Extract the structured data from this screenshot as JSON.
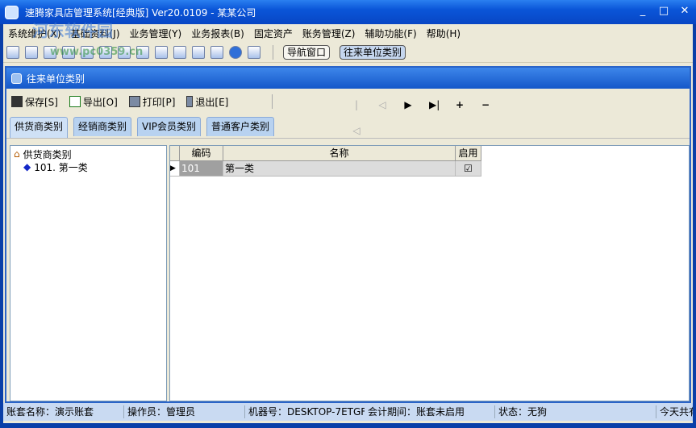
{
  "window": {
    "title": "速腾家具店管理系统[经典版] Ver20.0109  -  某某公司",
    "watermark": {
      "site_name": "河东软件园",
      "url": "www.pc0359.cn"
    }
  },
  "menu": [
    "系统维护(X)",
    "基础资料(J)",
    "业务管理(Y)",
    "业务报表(B)",
    "固定资产",
    "账务管理(Z)",
    "辅助功能(F)",
    "帮助(H)"
  ],
  "toolbar": {
    "icons": [
      "grid-icon",
      "form-icon",
      "windows-icon",
      "search-doc-icon",
      "money-icon",
      "edit-icon",
      "users-icon",
      "print-doc-icon",
      "notes-icon",
      "calculator-icon",
      "save-icon",
      "printer-icon",
      "help-icon",
      "exit-icon"
    ],
    "nav_buttons": [
      "导航窗口",
      "往来单位类别"
    ]
  },
  "child": {
    "title": "往来单位类别",
    "actions": [
      "保存[S]",
      "导出[O]",
      "打印[P]",
      "退出[E]"
    ],
    "nav": [
      "|◁",
      "◁",
      "▶",
      "▶|",
      "+",
      "−"
    ],
    "tabs": [
      "供货商类别",
      "经销商类别",
      "VIP会员类别",
      "普通客户类别"
    ],
    "tree": {
      "root": "供货商类别",
      "children": [
        "101. 第一类"
      ]
    },
    "grid": {
      "columns": [
        "编码",
        "名称",
        "启用"
      ],
      "rows": [
        {
          "code": "101",
          "name": "第一类",
          "enabled": true
        }
      ]
    }
  },
  "status": [
    "账套名称：演示账套",
    "操作员：管理员",
    "机器号：DESKTOP-7ETGF(",
    "会计期间：账套未启用",
    "状态：无狗",
    "今天共有"
  ]
}
